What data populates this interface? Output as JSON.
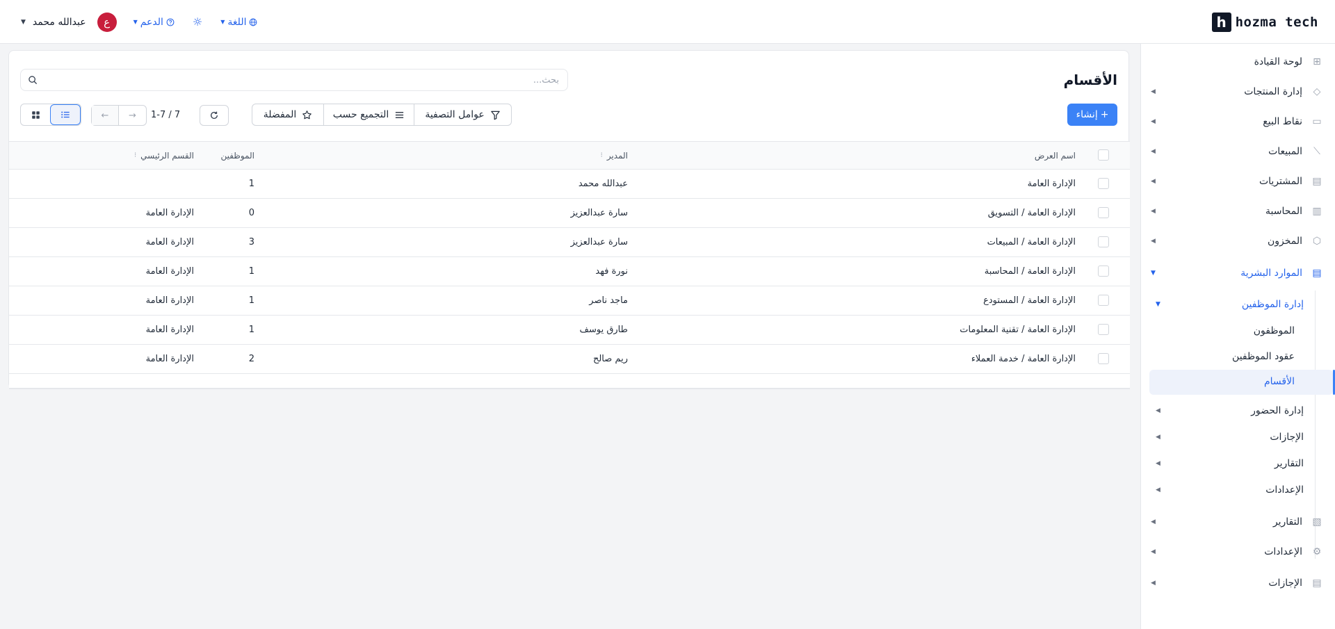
{
  "brand": {
    "mark": "h",
    "name": "hozma tech"
  },
  "topbar": {
    "user_name": "عبدالله محمد",
    "avatar_letter": "ع",
    "support": "الدعم",
    "language": "اللغة"
  },
  "sidebar": {
    "items": [
      {
        "label": "لوحة القيادة"
      },
      {
        "label": "إدارة المنتجات"
      },
      {
        "label": "نقاط البيع"
      },
      {
        "label": "المبيعات"
      },
      {
        "label": "المشتريات"
      },
      {
        "label": "المحاسبة"
      },
      {
        "label": "المخزون"
      },
      {
        "label": "الموارد البشرية"
      }
    ],
    "hr_submenu": {
      "employees_mgmt": "إدارة الموظفين",
      "employees": "الموظفون",
      "contracts": "عقود الموظفين",
      "departments": "الأقسام",
      "attendance": "إدارة الحضور",
      "leaves": "الإجازات",
      "reports": "التقارير",
      "settings": "الإعدادات"
    },
    "bottom_items": [
      {
        "label": "التقارير"
      },
      {
        "label": "الإعدادات"
      },
      {
        "label": "الإجازات"
      }
    ]
  },
  "main": {
    "title": "الأقسام",
    "search_placeholder": "بحث...",
    "create_label": "إنشاء",
    "filters_label": "عوامل التصفية",
    "group_by_label": "التجميع حسب",
    "favorites_label": "المفضلة",
    "pager": "1-7 / 7"
  },
  "table": {
    "columns": {
      "name": "اسم العرض",
      "manager": "المدير",
      "employees": "الموظفين",
      "parent": "القسم الرئيسي"
    },
    "rows": [
      {
        "name": "الإدارة العامة",
        "manager": "عبدالله محمد",
        "employees": "1",
        "parent": ""
      },
      {
        "name": "الإدارة العامة / التسويق",
        "manager": "سارة عبدالعزيز",
        "employees": "0",
        "parent": "الإدارة العامة"
      },
      {
        "name": "الإدارة العامة / المبيعات",
        "manager": "سارة عبدالعزيز",
        "employees": "3",
        "parent": "الإدارة العامة"
      },
      {
        "name": "الإدارة العامة / المحاسبة",
        "manager": "نورة فهد",
        "employees": "1",
        "parent": "الإدارة العامة"
      },
      {
        "name": "الإدارة العامة / المستودع",
        "manager": "ماجد ناصر",
        "employees": "1",
        "parent": "الإدارة العامة"
      },
      {
        "name": "الإدارة العامة / تقنية المعلومات",
        "manager": "طارق يوسف",
        "employees": "1",
        "parent": "الإدارة العامة"
      },
      {
        "name": "الإدارة العامة / خدمة العملاء",
        "manager": "ريم صالح",
        "employees": "2",
        "parent": "الإدارة العامة"
      }
    ]
  },
  "colors": {
    "accent": "#3b82f6",
    "avatar": "#c81e3c",
    "link": "#2563eb"
  }
}
